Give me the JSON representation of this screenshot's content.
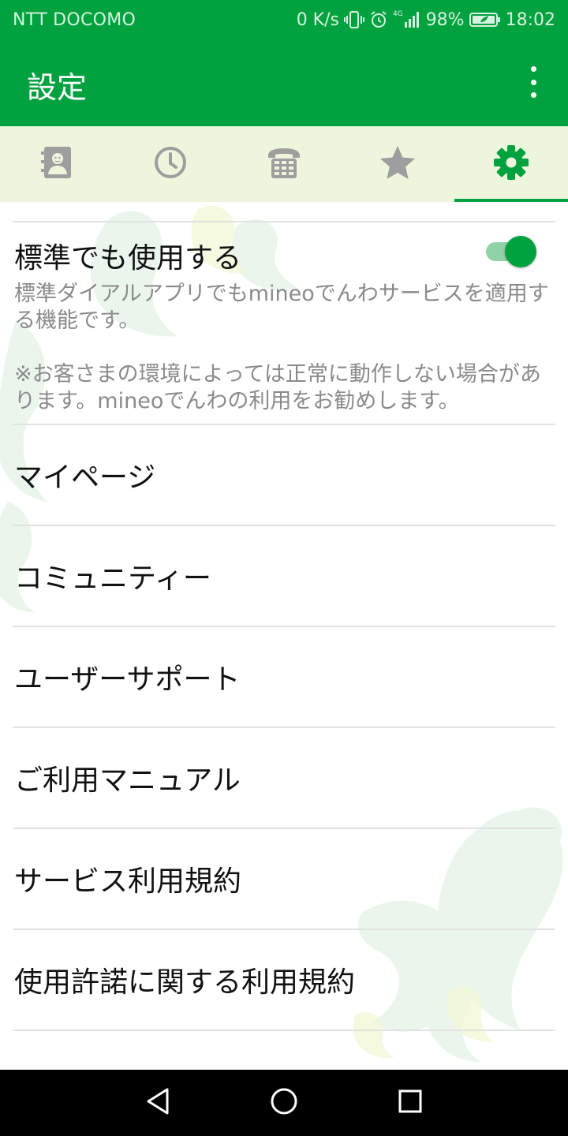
{
  "status_bar": {
    "carrier": "NTT DOCOMO",
    "net_speed": "0 K/s",
    "network_badge": "4G",
    "battery": "98%",
    "time": "18:02"
  },
  "app_bar": {
    "title": "設定"
  },
  "tabs": [
    {
      "icon": "contacts-icon",
      "active": false
    },
    {
      "icon": "history-icon",
      "active": false
    },
    {
      "icon": "dialpad-icon",
      "active": false
    },
    {
      "icon": "favorites-star-icon",
      "active": false
    },
    {
      "icon": "settings-gear-icon",
      "active": true
    }
  ],
  "default_setting": {
    "label": "標準でも使用する",
    "enabled": true,
    "description": "標準ダイアルアプリでもmineoでんわサービスを適用する機能です。\n\n※お客さまの環境によっては正常に動作しない場合があります。mineoでんわの利用をお勧めします。"
  },
  "menu": [
    {
      "label": "マイページ"
    },
    {
      "label": "コミュニティー"
    },
    {
      "label": "ユーザーサポート"
    },
    {
      "label": "ご利用マニュアル"
    },
    {
      "label": "サービス利用規約"
    },
    {
      "label": "使用許諾に関する利用規約"
    }
  ],
  "colors": {
    "primary": "#00a23f",
    "tab_background": "#eef5dd",
    "inactive_icon": "#9e9e9e",
    "secondary_text": "#8a8a8a"
  }
}
